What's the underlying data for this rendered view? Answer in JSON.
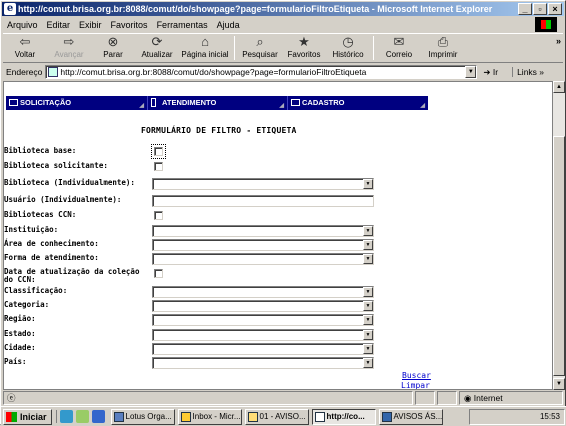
{
  "window": {
    "title": "http://comut.brisa.org.br:8088/comut/do/showpage?page=formularioFiltroEtiqueta - Microsoft Internet Explorer"
  },
  "menu": [
    "Arquivo",
    "Editar",
    "Exibir",
    "Favoritos",
    "Ferramentas",
    "Ajuda"
  ],
  "toolbar": {
    "buttons": [
      {
        "label": "Voltar",
        "icon": "back-arrow-icon"
      },
      {
        "label": "Avançar",
        "icon": "forward-arrow-icon"
      },
      {
        "label": "Parar",
        "icon": "stop-icon"
      },
      {
        "label": "Atualizar",
        "icon": "refresh-icon"
      },
      {
        "label": "Página inicial",
        "icon": "home-icon"
      },
      {
        "label": "Pesquisar",
        "icon": "search-icon"
      },
      {
        "label": "Favoritos",
        "icon": "favorites-icon"
      },
      {
        "label": "Histórico",
        "icon": "history-icon"
      },
      {
        "label": "Correio",
        "icon": "mail-icon"
      },
      {
        "label": "Imprimir",
        "icon": "print-icon"
      }
    ],
    "more": "»"
  },
  "address": {
    "label": "Endereço",
    "url": "http://comut.brisa.org.br:8088/comut/do/showpage?page=formularioFiltroEtiqueta",
    "go": "Ir",
    "links": "Links »"
  },
  "nav": {
    "items": [
      "SOLICITAÇÃO",
      "ATENDIMENTO",
      "CADASTRO"
    ]
  },
  "form": {
    "title": "FORMULÁRIO DE FILTRO - ETIQUETA",
    "fields": [
      {
        "label": "Biblioteca base:",
        "type": "checkbox"
      },
      {
        "label": "Biblioteca solicitante:",
        "type": "checkbox"
      },
      {
        "label": "Biblioteca (Individualmente):",
        "type": "select"
      },
      {
        "label": "Usuário (Individualmente):",
        "type": "text"
      },
      {
        "label": "Bibliotecas CCN:",
        "type": "checkbox"
      },
      {
        "label": "Instituição:",
        "type": "select"
      },
      {
        "label": "Área de conhecimento:",
        "type": "select"
      },
      {
        "label": "Forma de atendimento:",
        "type": "select"
      },
      {
        "label": "Data de atualização da coleção do CCN:",
        "type": "checkbox"
      },
      {
        "label": "Classificação:",
        "type": "select"
      },
      {
        "label": "Categoria:",
        "type": "select"
      },
      {
        "label": "Região:",
        "type": "select"
      },
      {
        "label": "Estado:",
        "type": "select"
      },
      {
        "label": "Cidade:",
        "type": "select"
      },
      {
        "label": "País:",
        "type": "select"
      }
    ],
    "buscar": "Buscar",
    "limpar": "Limpar"
  },
  "status": {
    "zone": "Internet"
  },
  "taskbar": {
    "start": "Iniciar",
    "tasks": [
      "Lotus Orga...",
      "Inbox - Micr...",
      "01 - AVISO...",
      "http://co...",
      "AVISOS ÁS..."
    ],
    "clock": "15:53"
  }
}
